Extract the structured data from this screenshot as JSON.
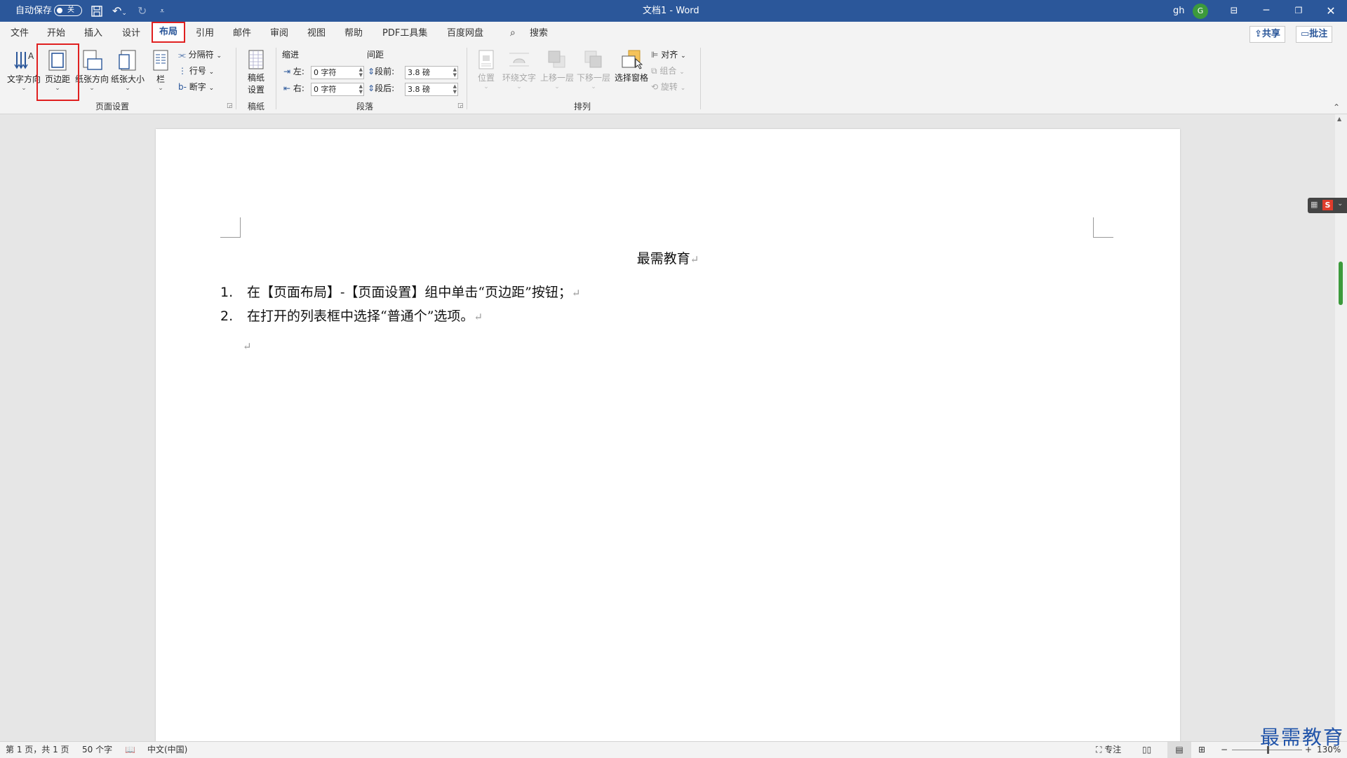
{
  "titlebar": {
    "autosave_label": "自动保存",
    "autosave_state": "关",
    "doc_title": "文档1  -  Word",
    "user": "gh",
    "avatar": "G",
    "icons": [
      "save-icon",
      "undo-icon",
      "redo-icon",
      "customize-icon",
      "ribbon-display-icon",
      "minimize-icon",
      "restore-icon",
      "close-icon"
    ]
  },
  "menu": {
    "tabs": [
      "文件",
      "开始",
      "插入",
      "设计",
      "布局",
      "引用",
      "邮件",
      "审阅",
      "视图",
      "帮助",
      "PDF工具集",
      "百度网盘"
    ],
    "active_tab": "布局",
    "search": "搜索",
    "share": "共享",
    "comment": "批注"
  },
  "ribbon": {
    "page_setup": {
      "text_direction": "文字方向",
      "margins": "页边距",
      "orientation": "纸张方向",
      "size": "纸张大小",
      "columns": "栏",
      "breaks": "分隔符",
      "line_numbers": "行号",
      "hyphenation": "断字",
      "label": "页面设置"
    },
    "manuscript": {
      "settings_line1": "稿纸",
      "settings_line2": "设置",
      "label": "稿纸"
    },
    "paragraph": {
      "indent": "缩进",
      "spacing": "间距",
      "left": "左:",
      "right": "右:",
      "before": "段前:",
      "after": "段后:",
      "left_value": "0 字符",
      "right_value": "0 字符",
      "before_value": "3.8 磅",
      "after_value": "3.8 磅",
      "label": "段落"
    },
    "arrange": {
      "position": "位置",
      "wrap_text": "环绕文字",
      "bring_forward": "上移一层",
      "send_backward": "下移一层",
      "selection_pane": "选择窗格",
      "align": "对齐",
      "group": "组合",
      "rotate": "旋转",
      "label": "排列"
    }
  },
  "document": {
    "title": "最需教育",
    "items": [
      {
        "num": "1.",
        "text": "在【页面布局】-【页面设置】组中单击“页边距”按钮；"
      },
      {
        "num": "2.",
        "text": "在打开的列表框中选择“普通个”选项。"
      }
    ],
    "para_mark": "↵"
  },
  "status": {
    "page": "第 1 页，共 1 页",
    "words": "50 个字",
    "language": "中文(中国)",
    "focus": "专注",
    "zoom": "130%"
  },
  "watermark": "最需教育",
  "colors": {
    "titlebar": "#2b579a",
    "highlight": "#e02020"
  }
}
